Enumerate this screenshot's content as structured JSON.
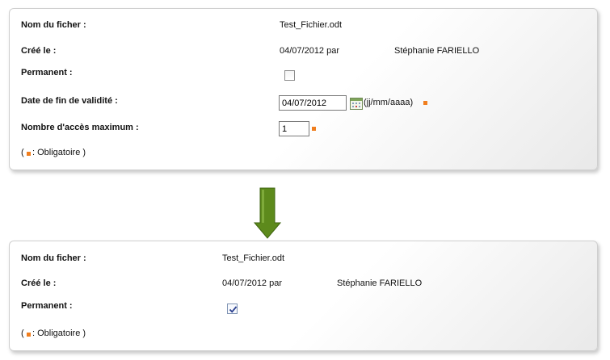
{
  "top_panel": {
    "file_name_label": "Nom du ficher :",
    "file_name_value": "Test_Fichier.odt",
    "created_label": "Créé le :",
    "created_date": "04/07/2012 par",
    "created_by": "Stéphanie FARIELLO",
    "permanent_label": "Permanent :",
    "permanent_checked": false,
    "end_date_label": "Date de fin de validité :",
    "end_date_value": "04/07/2012",
    "date_format": "(jj/mm/aaaa)",
    "max_access_label": "Nombre d'accès maximum :",
    "max_access_value": "1",
    "required_open": "(",
    "required_note": ": Obligatoire )"
  },
  "bottom_panel": {
    "file_name_label": "Nom du ficher :",
    "file_name_value": "Test_Fichier.odt",
    "created_label": "Créé le :",
    "created_date": "04/07/2012 par",
    "created_by": "Stéphanie FARIELLO",
    "permanent_label": "Permanent :",
    "permanent_checked": true,
    "required_open": "(",
    "required_note": ": Obligatoire )"
  },
  "colors": {
    "required_marker": "#f07e1e",
    "arrow_fill": "#5d8a1c",
    "check_mark": "#2a3f8f"
  },
  "icons": {
    "calendar": "calendar-icon",
    "arrow": "arrow-down-icon"
  }
}
